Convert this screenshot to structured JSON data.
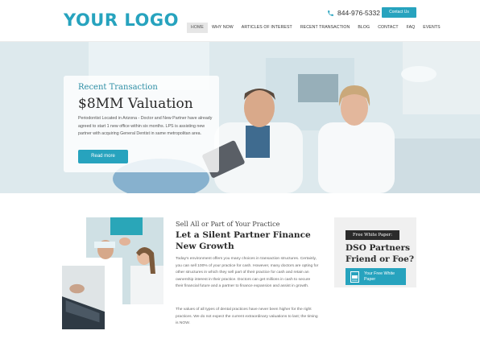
{
  "header": {
    "logo": "YOUR LOGO",
    "phone": "844-976-5332",
    "contact_label": "Contact Us",
    "nav": [
      "HOME",
      "WHY NOW",
      "ARTICLES OF INTEREST",
      "RECENT TRANSACTION",
      "BLOG",
      "CONTACT",
      "FAQ",
      "EVENTS"
    ],
    "active_nav": "HOME"
  },
  "hero": {
    "eyebrow": "Recent Transaction",
    "title": "$8MM Valuation",
    "text": "Periodontist Located in Arizona - Doctor and New Partner have already agreed to start 1 new office within six months. LPS is assisting new partner with acquiring General Dentist in same metropolitan area.",
    "button": "Read more"
  },
  "main": {
    "eyebrow": "Sell All or Part of Your Practice",
    "title": "Let a Silent Partner Finance New Growth",
    "paragraph1": "Today's environment offers you many choices in transaction structures. Certainly, you can sell 100% of your practice for cash. However, many doctors are opting for other structures in which they sell part of their practice for cash and retain an ownership interest in their practice. Doctors can get millions in cash to secure their financial future and a partner to finance expansion and assist in growth.",
    "paragraph2": "The values of all types of dental practices have never been higher for the right practices. We do not expect the current extraordinary valuations to last; the timing is NOW."
  },
  "sidebar": {
    "label": "Free White Paper:",
    "title": "DSO Partners Friend or Foe?",
    "button": "Your Free White Paper"
  },
  "colors": {
    "accent": "#27a3be",
    "dark": "#2b2b2b",
    "panel": "#f0f0f0"
  }
}
